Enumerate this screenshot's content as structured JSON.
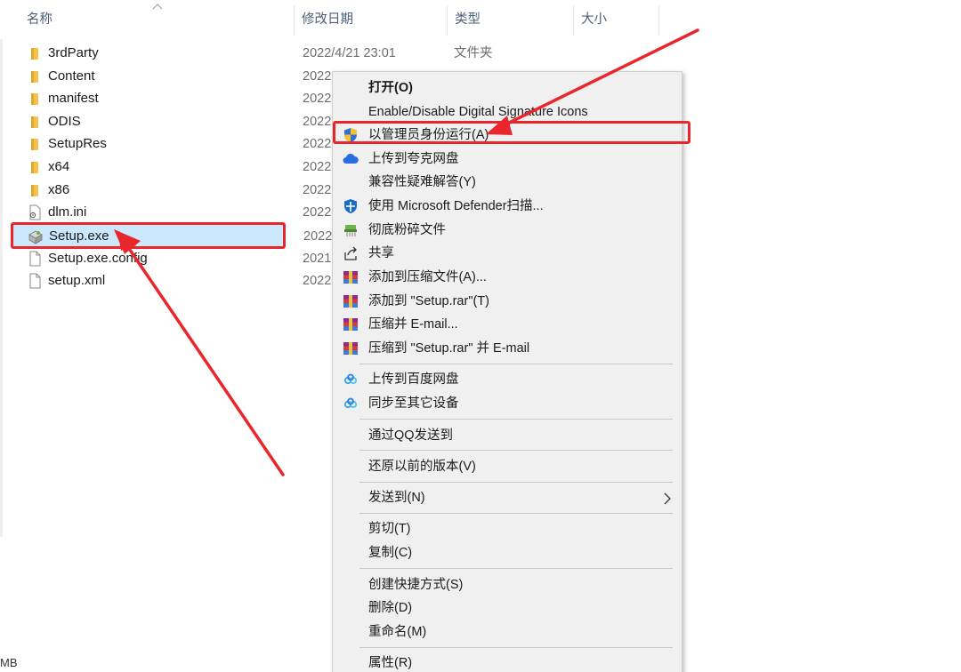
{
  "columns": {
    "name": "名称",
    "modified": "修改日期",
    "type": "类型",
    "size": "大小"
  },
  "files": [
    {
      "name": "3rdParty",
      "date": "2022/4/21 23:01",
      "type": "文件夹",
      "icon": "folder-icon"
    },
    {
      "name": "Content",
      "date": "2022",
      "type": "",
      "icon": "folder-icon"
    },
    {
      "name": "manifest",
      "date": "2022",
      "type": "",
      "icon": "folder-icon"
    },
    {
      "name": "ODIS",
      "date": "2022",
      "type": "",
      "icon": "folder-icon"
    },
    {
      "name": "SetupRes",
      "date": "2022",
      "type": "",
      "icon": "folder-icon"
    },
    {
      "name": "x64",
      "date": "2022",
      "type": "",
      "icon": "folder-icon"
    },
    {
      "name": "x86",
      "date": "2022",
      "type": "",
      "icon": "folder-icon"
    },
    {
      "name": "dlm.ini",
      "date": "2022",
      "type": "",
      "icon": "ini-file-icon"
    },
    {
      "name": "Setup.exe",
      "date": "2022",
      "type": "",
      "icon": "installer-icon"
    },
    {
      "name": "Setup.exe.config",
      "date": "2021",
      "type": "",
      "icon": "file-icon"
    },
    {
      "name": "setup.xml",
      "date": "2022",
      "type": "",
      "icon": "file-icon"
    }
  ],
  "status": {
    "size_unit": "MB"
  },
  "context_menu": {
    "items": [
      {
        "label": "打开(O)",
        "icon": ""
      },
      {
        "label": "Enable/Disable Digital Signature Icons",
        "icon": ""
      },
      {
        "label": "以管理员身份运行(A)",
        "icon": "uac-shield-icon"
      },
      {
        "label": "上传到夸克网盘",
        "icon": "quark-cloud-icon"
      },
      {
        "label": "兼容性疑难解答(Y)",
        "icon": ""
      },
      {
        "label": "使用 Microsoft Defender扫描...",
        "icon": "defender-icon"
      },
      {
        "label": "彻底粉碎文件",
        "icon": "shredder-icon"
      },
      {
        "label": "共享",
        "icon": "share-icon"
      },
      {
        "label": "添加到压缩文件(A)...",
        "icon": "winrar-icon"
      },
      {
        "label": "添加到 \"Setup.rar\"(T)",
        "icon": "winrar-icon"
      },
      {
        "label": "压缩并 E-mail...",
        "icon": "winrar-icon"
      },
      {
        "label": "压缩到 \"Setup.rar\" 并 E-mail",
        "icon": "winrar-icon"
      },
      {
        "label": "上传到百度网盘",
        "icon": "baidu-cloud-icon"
      },
      {
        "label": "同步至其它设备",
        "icon": "baidu-cloud-icon"
      },
      {
        "label": "通过QQ发送到",
        "icon": ""
      },
      {
        "label": "还原以前的版本(V)",
        "icon": ""
      },
      {
        "label": "发送到(N)",
        "icon": "",
        "submenu": true
      },
      {
        "label": "剪切(T)",
        "icon": ""
      },
      {
        "label": "复制(C)",
        "icon": ""
      },
      {
        "label": "创建快捷方式(S)",
        "icon": ""
      },
      {
        "label": "删除(D)",
        "icon": ""
      },
      {
        "label": "重命名(M)",
        "icon": ""
      },
      {
        "label": "属性(R)",
        "icon": ""
      }
    ]
  },
  "colors": {
    "highlight": "#e8262b",
    "selection_bg": "#cce8ff",
    "folder": "#f2c14e"
  }
}
